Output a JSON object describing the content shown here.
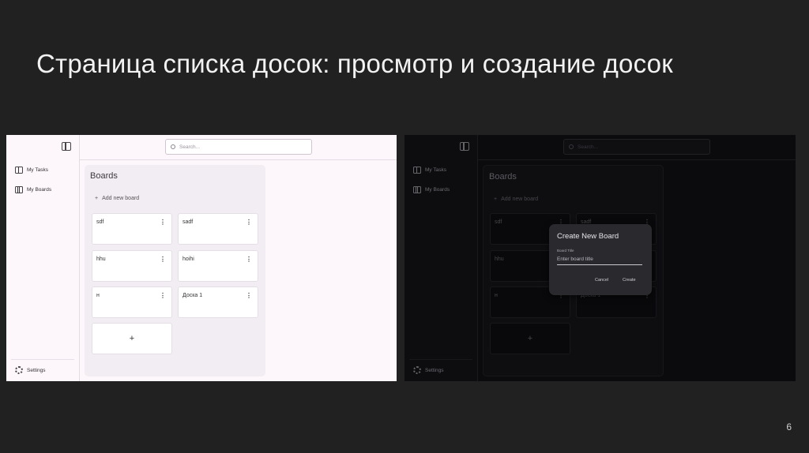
{
  "slide": {
    "title": "Страница списка досок: просмотр и создание досок",
    "page_number": "6"
  },
  "app": {
    "search_placeholder": "Search...",
    "nav": {
      "my_tasks": "My Tasks",
      "my_boards": "My Boards",
      "settings": "Settings"
    },
    "boards_title": "Boards",
    "add_new_board": "Add new board",
    "add_icon": "+",
    "menu_glyph": "⋮",
    "boards": [
      "sdf",
      "sadf",
      "hhu",
      "hoihi",
      "н",
      "Доска 1"
    ],
    "add_card_glyph": "+",
    "dialog": {
      "title": "Create New Board",
      "field_label": "Board Title",
      "placeholder": "Enter board title",
      "cancel": "Cancel",
      "create": "Create"
    }
  },
  "icons": [
    "sidebar-toggle-icon",
    "book-icon",
    "board-icon",
    "gear-icon",
    "search-icon"
  ],
  "colors": {
    "slide_bg": "#212121",
    "light_bg": "#fdf6fb",
    "dark_bg": "#121116",
    "dialog_bg": "#2a292e"
  }
}
